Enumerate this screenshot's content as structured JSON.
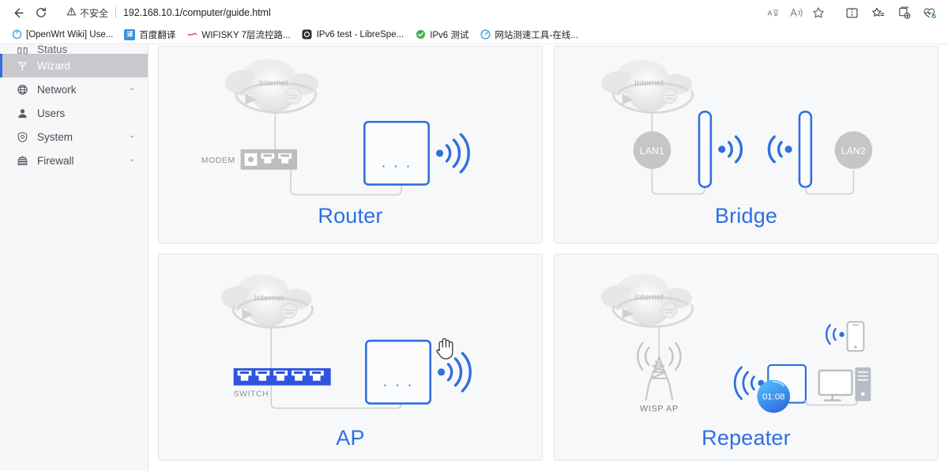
{
  "browser": {
    "back_label": "Back",
    "refresh_label": "Refresh",
    "security_text": "不安全",
    "url": "192.168.10.1/computer/guide.html",
    "translate_icon_label": "aあ",
    "read_aloud_label": "read-aloud",
    "favorite_label": "favorite",
    "split_screen_label": "split-screen",
    "favorites_label": "favorites",
    "collections_label": "collections",
    "essentials_label": "browser-essentials"
  },
  "bookmarks": [
    {
      "title": "[OpenWrt Wiki] Use...",
      "icon": "openwrt",
      "color": "#3aa7d6"
    },
    {
      "title": "百度翻译",
      "icon": "translate",
      "color": "#3b8fe0"
    },
    {
      "title": "WIFISKY 7层流控路...",
      "icon": "wifisky",
      "color": "#e05a5a"
    },
    {
      "title": "IPv6 test - LibreSpe...",
      "icon": "ipv6test",
      "color": "#2b2b2b"
    },
    {
      "title": "IPv6 测试",
      "icon": "check",
      "color": "#49b24a"
    },
    {
      "title": "网站测速工具-在线...",
      "icon": "speed",
      "color": "#4aa3e0"
    }
  ],
  "sidebar": {
    "items": [
      {
        "label": "Status",
        "icon": "status-icon",
        "caret": "",
        "active": false,
        "clipped": true
      },
      {
        "label": "Wizard",
        "icon": "wizard-icon",
        "caret": "",
        "active": true,
        "clipped": false
      },
      {
        "label": "Network",
        "icon": "network-icon",
        "caret": "⌄",
        "active": false,
        "clipped": false
      },
      {
        "label": "Users",
        "icon": "users-icon",
        "caret": "",
        "active": false,
        "clipped": false
      },
      {
        "label": "System",
        "icon": "system-icon",
        "caret": "⌄",
        "active": false,
        "clipped": false
      },
      {
        "label": "Firewall",
        "icon": "firewall-icon",
        "caret": "⌄",
        "active": false,
        "clipped": false
      }
    ]
  },
  "modes": {
    "router": {
      "title": "Router",
      "internet_label": "Internet",
      "device_label": "MODEM",
      "dots": "· · ·"
    },
    "bridge": {
      "title": "Bridge",
      "internet_label": "Internet",
      "lan1_label": "LAN1",
      "lan2_label": "LAN2"
    },
    "ap": {
      "title": "AP",
      "internet_label": "Internet",
      "device_label": "SWITCH",
      "dots": "· · ·"
    },
    "repeater": {
      "title": "Repeater",
      "internet_label": "Internet",
      "wisp_label": "WISP AP",
      "timer": "01:08"
    }
  },
  "colors": {
    "accent_blue": "#2f6fe0",
    "gray_device": "#bdbdbd",
    "card_bg": "#f7f8fa",
    "sidebar_bg": "#f7f7f9",
    "active_bg": "#c9c9cd"
  }
}
